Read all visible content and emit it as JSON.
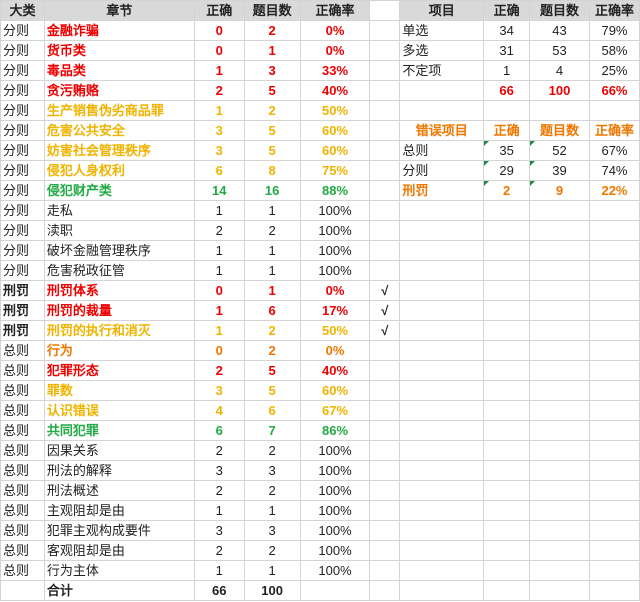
{
  "colors": {
    "red": "#ee0000",
    "orange": "#f07800",
    "gold": "#f0b400",
    "green": "#22aa44",
    "header_bg": "#d9d9d9",
    "grid": "#d4d4d4",
    "check_blue": "#2e75b6"
  },
  "left_headers": [
    "大类",
    "章节",
    "正确",
    "题目数",
    "正确率"
  ],
  "left_rows": [
    {
      "cat": "分则",
      "chapter": "金融诈骗",
      "correct": "0",
      "total": "2",
      "rate": "0%",
      "color": "red",
      "check": ""
    },
    {
      "cat": "分则",
      "chapter": "货币类",
      "correct": "0",
      "total": "1",
      "rate": "0%",
      "color": "red",
      "check": ""
    },
    {
      "cat": "分则",
      "chapter": "毒品类",
      "correct": "1",
      "total": "3",
      "rate": "33%",
      "color": "red",
      "check": ""
    },
    {
      "cat": "分则",
      "chapter": "贪污贿赂",
      "correct": "2",
      "total": "5",
      "rate": "40%",
      "color": "red",
      "check": ""
    },
    {
      "cat": "分则",
      "chapter": "生产销售伪劣商品罪",
      "correct": "1",
      "total": "2",
      "rate": "50%",
      "color": "gold",
      "check": ""
    },
    {
      "cat": "分则",
      "chapter": "危害公共安全",
      "correct": "3",
      "total": "5",
      "rate": "60%",
      "color": "gold",
      "check": ""
    },
    {
      "cat": "分则",
      "chapter": "妨害社会管理秩序",
      "correct": "3",
      "total": "5",
      "rate": "60%",
      "color": "gold",
      "check": ""
    },
    {
      "cat": "分则",
      "chapter": "侵犯人身权利",
      "correct": "6",
      "total": "8",
      "rate": "75%",
      "color": "gold",
      "check": ""
    },
    {
      "cat": "分则",
      "chapter": "侵犯财产类",
      "correct": "14",
      "total": "16",
      "rate": "88%",
      "color": "green",
      "check": ""
    },
    {
      "cat": "分则",
      "chapter": "走私",
      "correct": "1",
      "total": "1",
      "rate": "100%",
      "color": "",
      "check": ""
    },
    {
      "cat": "分则",
      "chapter": "渎职",
      "correct": "2",
      "total": "2",
      "rate": "100%",
      "color": "",
      "check": ""
    },
    {
      "cat": "分则",
      "chapter": "破坏金融管理秩序",
      "correct": "1",
      "total": "1",
      "rate": "100%",
      "color": "",
      "check": ""
    },
    {
      "cat": "分则",
      "chapter": "危害税政征管",
      "correct": "1",
      "total": "1",
      "rate": "100%",
      "color": "",
      "check": ""
    },
    {
      "cat": "刑罚",
      "chapter": "刑罚体系",
      "correct": "0",
      "total": "1",
      "rate": "0%",
      "color": "red",
      "check": "√"
    },
    {
      "cat": "刑罚",
      "chapter": "刑罚的裁量",
      "correct": "1",
      "total": "6",
      "rate": "17%",
      "color": "red",
      "check": "√"
    },
    {
      "cat": "刑罚",
      "chapter": "刑罚的执行和消灭",
      "correct": "1",
      "total": "2",
      "rate": "50%",
      "color": "gold",
      "check": "√"
    },
    {
      "cat": "总则",
      "chapter": "行为",
      "correct": "0",
      "total": "2",
      "rate": "0%",
      "color": "orange",
      "check": ""
    },
    {
      "cat": "总则",
      "chapter": "犯罪形态",
      "correct": "2",
      "total": "5",
      "rate": "40%",
      "color": "red",
      "check": ""
    },
    {
      "cat": "总则",
      "chapter": "罪数",
      "correct": "3",
      "total": "5",
      "rate": "60%",
      "color": "gold",
      "check": ""
    },
    {
      "cat": "总则",
      "chapter": "认识错误",
      "correct": "4",
      "total": "6",
      "rate": "67%",
      "color": "gold",
      "check": ""
    },
    {
      "cat": "总则",
      "chapter": "共同犯罪",
      "correct": "6",
      "total": "7",
      "rate": "86%",
      "color": "green",
      "check": ""
    },
    {
      "cat": "总则",
      "chapter": "因果关系",
      "correct": "2",
      "total": "2",
      "rate": "100%",
      "color": "",
      "check": ""
    },
    {
      "cat": "总则",
      "chapter": "刑法的解释",
      "correct": "3",
      "total": "3",
      "rate": "100%",
      "color": "",
      "check": ""
    },
    {
      "cat": "总则",
      "chapter": "刑法概述",
      "correct": "2",
      "total": "2",
      "rate": "100%",
      "color": "",
      "check": ""
    },
    {
      "cat": "总则",
      "chapter": "主观阻却是由",
      "correct": "1",
      "total": "1",
      "rate": "100%",
      "color": "",
      "check": ""
    },
    {
      "cat": "总则",
      "chapter": "犯罪主观构成要件",
      "correct": "3",
      "total": "3",
      "rate": "100%",
      "color": "",
      "check": ""
    },
    {
      "cat": "总则",
      "chapter": "客观阻却是由",
      "correct": "2",
      "total": "2",
      "rate": "100%",
      "color": "",
      "check": ""
    },
    {
      "cat": "总则",
      "chapter": "行为主体",
      "correct": "1",
      "total": "1",
      "rate": "100%",
      "color": "",
      "check": ""
    }
  ],
  "left_total": {
    "label": "合计",
    "correct": "66",
    "total": "100"
  },
  "right_table1": {
    "headers": [
      "项目",
      "正确",
      "题目数",
      "正确率"
    ],
    "rows": [
      {
        "item": "单选",
        "correct": "34",
        "total": "43",
        "rate": "79%"
      },
      {
        "item": "多选",
        "correct": "31",
        "53": "",
        "total": "53",
        "rate": "58%"
      },
      {
        "item": "不定项",
        "correct": "1",
        "total": "4",
        "rate": "25%"
      }
    ],
    "summary": {
      "correct": "66",
      "total": "100",
      "rate": "66%"
    }
  },
  "right_table2": {
    "headers": [
      "错误项目",
      "正确",
      "题目数",
      "正确率"
    ],
    "rows": [
      {
        "item": "总则",
        "correct": "35",
        "total": "52",
        "rate": "67%",
        "color": ""
      },
      {
        "item": "分则",
        "correct": "29",
        "total": "39",
        "rate": "74%",
        "color": ""
      },
      {
        "item": "刑罚",
        "correct": "2",
        "total": "9",
        "rate": "22%",
        "color": "orange"
      }
    ]
  }
}
